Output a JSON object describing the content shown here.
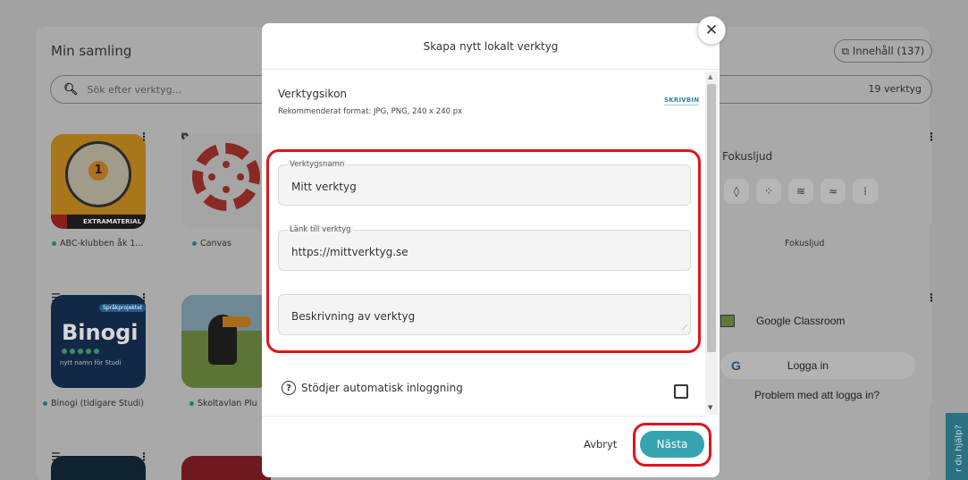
{
  "background": {
    "collection_title": "Min samling",
    "content_button": "Innehåll (137)",
    "search_placeholder": "Sök efter verktyg...",
    "tool_count": "19 verktyg",
    "tiles": [
      {
        "label": "ABC-klubben åk 1...",
        "badge": "EXTRAMATERIAL"
      },
      {
        "label": "Canvas"
      },
      {
        "label": "Binogi (tidigare Studi)",
        "title": "Binogi",
        "pill": "Språkprojektet",
        "sub": "nytt namn för Studi"
      },
      {
        "label": "Skoltavlan Plu"
      }
    ],
    "fokus": {
      "title": "Fokusljud",
      "label": "Fokusljud",
      "icons": [
        "drop-icon",
        "sparkle-icon",
        "wind-icon",
        "waves-icon",
        "grid-icon"
      ]
    },
    "google_classroom": {
      "title": "Google Classroom",
      "login": "Logga in",
      "g": "G",
      "problem": "Problem med att logga in?"
    },
    "help_tab": "r du hjälp?"
  },
  "modal": {
    "title": "Skapa nytt lokalt verktyg",
    "close_symbol": "✕",
    "icon_section": {
      "title": "Verktygsikon",
      "subtitle": "Rekommenderat format: JPG, PNG, 240 x 240 px",
      "logo_text": "SKRIVBIN"
    },
    "fields": {
      "name": {
        "legend": "Verktygsnamn",
        "value": "Mitt verktyg"
      },
      "link": {
        "legend": "Länk till verktyg",
        "value": "https://mittverktyg.se"
      },
      "description": {
        "placeholder": "Beskrivning av verktyg"
      }
    },
    "auto_login": {
      "label": "Stödjer automatisk inloggning",
      "checked": false
    },
    "buttons": {
      "cancel": "Avbryt",
      "next": "Nästa"
    }
  },
  "colors": {
    "accent": "#36a3b1",
    "highlight": "#e0141c"
  }
}
